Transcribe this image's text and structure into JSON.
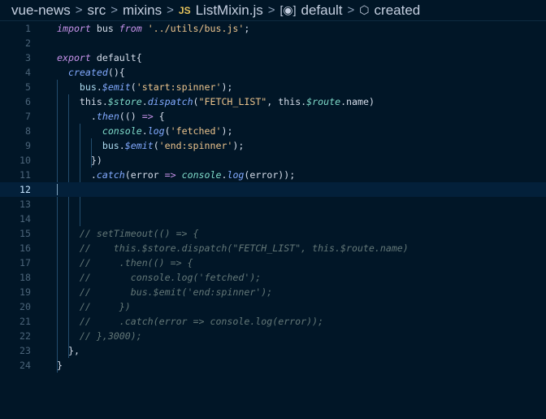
{
  "breadcrumb": {
    "items": [
      "vue-news",
      "src",
      "mixins",
      "ListMixin.js",
      "default",
      "created"
    ],
    "file_badge": "JS",
    "separator": ">"
  },
  "editor": {
    "current_line": 12,
    "lines": [
      [
        [
          "kw",
          "import"
        ],
        [
          "pl",
          " bus "
        ],
        [
          "kw",
          "from"
        ],
        [
          "str",
          " '../utils/bus.js'"
        ],
        [
          "pl",
          ";"
        ]
      ],
      [],
      [
        [
          "kw",
          "export"
        ],
        [
          "pl",
          " default{"
        ]
      ],
      [
        [
          "pl",
          "  "
        ],
        [
          "fn",
          "created"
        ],
        [
          "pl",
          "(){"
        ]
      ],
      [
        [
          "pl",
          "    "
        ],
        [
          "var",
          "bus"
        ],
        [
          "pl",
          "."
        ],
        [
          "fn",
          "$emit"
        ],
        [
          "pl",
          "("
        ],
        [
          "str",
          "'start:spinner'"
        ],
        [
          "pl",
          ");"
        ]
      ],
      [
        [
          "pl",
          "    this."
        ],
        [
          "prop",
          "$store"
        ],
        [
          "pl",
          "."
        ],
        [
          "fn",
          "dispatch"
        ],
        [
          "pl",
          "("
        ],
        [
          "str",
          "\"FETCH_LIST\""
        ],
        [
          "pl",
          ", this."
        ],
        [
          "prop",
          "$route"
        ],
        [
          "pl",
          ".name)"
        ]
      ],
      [
        [
          "pl",
          "      ."
        ],
        [
          "fn",
          "then"
        ],
        [
          "pl",
          "(() "
        ],
        [
          "op",
          "=>"
        ],
        [
          "pl",
          " {"
        ]
      ],
      [
        [
          "pl",
          "        "
        ],
        [
          "prop",
          "console"
        ],
        [
          "pl",
          "."
        ],
        [
          "fn",
          "log"
        ],
        [
          "pl",
          "("
        ],
        [
          "str",
          "'fetched'"
        ],
        [
          "pl",
          ");"
        ]
      ],
      [
        [
          "pl",
          "        "
        ],
        [
          "var",
          "bus"
        ],
        [
          "pl",
          "."
        ],
        [
          "fn",
          "$emit"
        ],
        [
          "pl",
          "("
        ],
        [
          "str",
          "'end:spinner'"
        ],
        [
          "pl",
          ");"
        ]
      ],
      [
        [
          "pl",
          "      })"
        ]
      ],
      [
        [
          "pl",
          "      ."
        ],
        [
          "fn",
          "catch"
        ],
        [
          "pl",
          "(error "
        ],
        [
          "op",
          "=>"
        ],
        [
          "pl",
          " "
        ],
        [
          "prop",
          "console"
        ],
        [
          "pl",
          "."
        ],
        [
          "fn",
          "log"
        ],
        [
          "pl",
          "(error));"
        ]
      ],
      [],
      [],
      [],
      [
        [
          "cm",
          "    // setTimeout(() => {"
        ]
      ],
      [
        [
          "cm",
          "    //    this.$store.dispatch(\"FETCH_LIST\", this.$route.name)"
        ]
      ],
      [
        [
          "cm",
          "    //     .then(() => {"
        ]
      ],
      [
        [
          "cm",
          "    //       console.log('fetched');"
        ]
      ],
      [
        [
          "cm",
          "    //       bus.$emit('end:spinner');"
        ]
      ],
      [
        [
          "cm",
          "    //     })"
        ]
      ],
      [
        [
          "cm",
          "    //     .catch(error => console.log(error));"
        ]
      ],
      [
        [
          "cm",
          "    // },3000);"
        ]
      ],
      [
        [
          "pl",
          "  },"
        ]
      ],
      [
        [
          "pl",
          "}"
        ]
      ]
    ]
  }
}
